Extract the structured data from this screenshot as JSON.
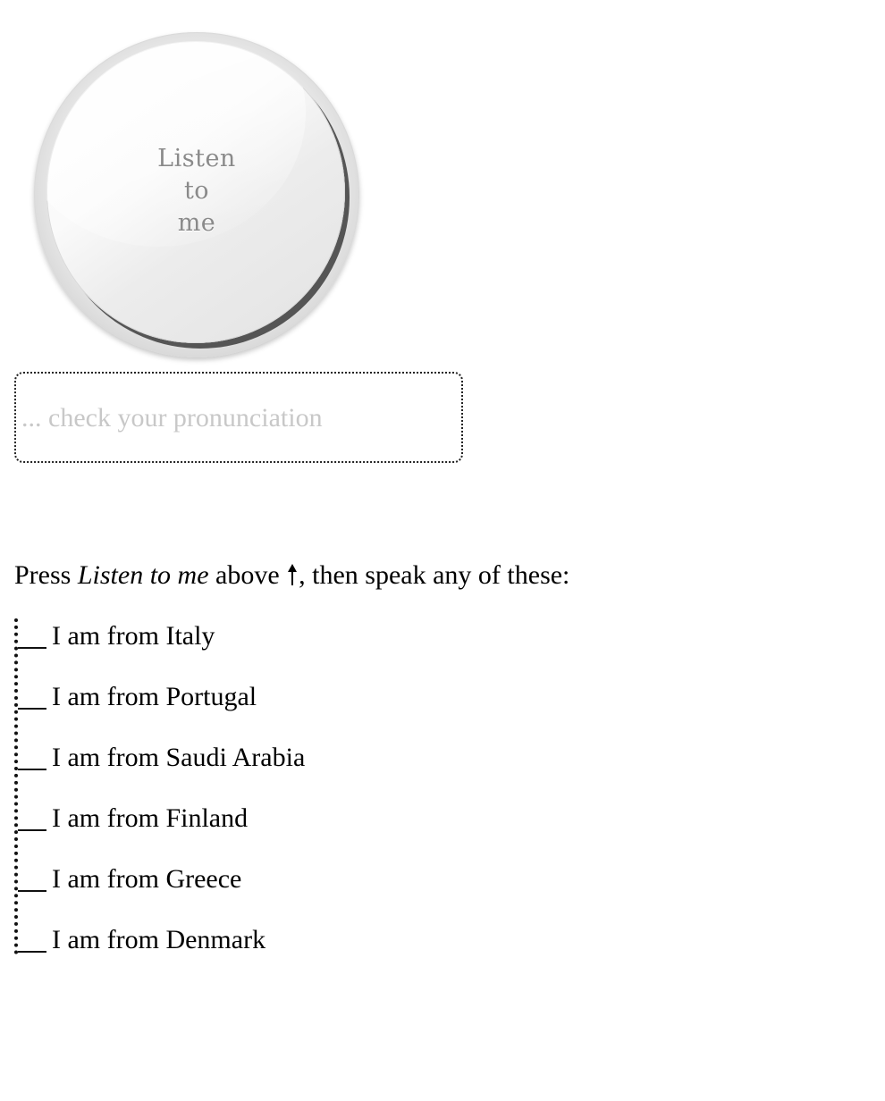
{
  "listen_button": {
    "line1": "Listen",
    "line2": "to",
    "line3": "me"
  },
  "output": {
    "placeholder": "... check your pronunciation"
  },
  "instruction": {
    "prefix": "Press ",
    "button_ref": "Listen to me",
    "middle": " above ",
    "arrow_icon": "up-arrow-icon",
    "suffix": ", then speak any of these:"
  },
  "phrases": [
    {
      "marker": "___",
      "text": "I am from Italy"
    },
    {
      "marker": "___",
      "text": "I am from Portugal"
    },
    {
      "marker": "___",
      "text": "I am from Saudi Arabia"
    },
    {
      "marker": "___",
      "text": "I am from Finland"
    },
    {
      "marker": "___",
      "text": "I am from Greece"
    },
    {
      "marker": "___",
      "text": "I am from Denmark"
    }
  ],
  "colors": {
    "placeholder": "#c8c8c8",
    "button_label": "#8a8a8a",
    "text": "#000000"
  }
}
